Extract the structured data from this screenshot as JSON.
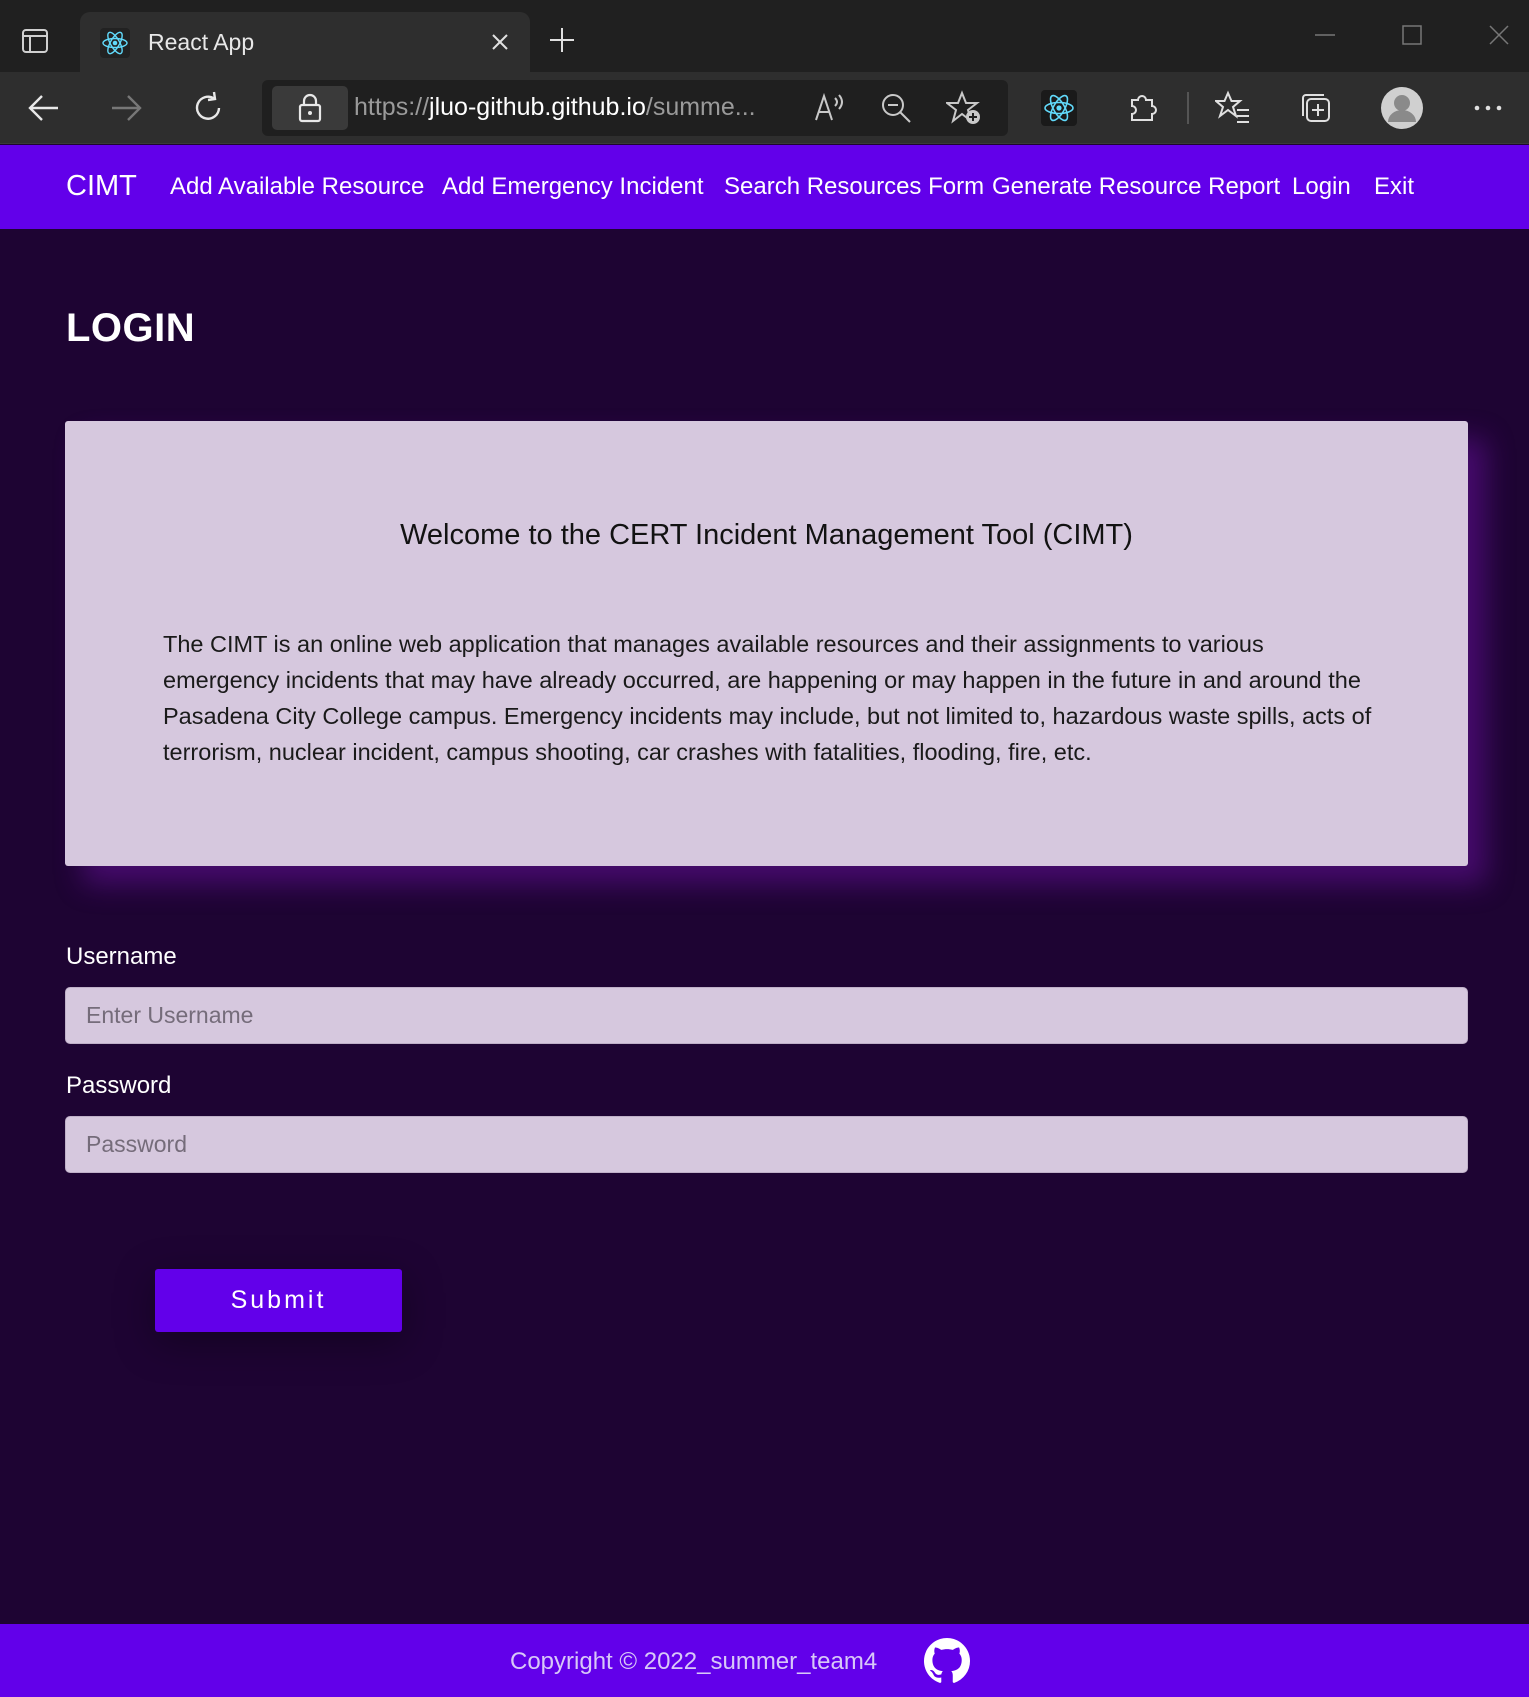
{
  "browser": {
    "tab_title": "React App",
    "url_scheme": "https://",
    "url_host": "jluo-github.github.io",
    "url_path": "/summe..."
  },
  "navbar": {
    "brand": "CIMT",
    "links": [
      "Add Available Resource",
      "Add Emergency Incident",
      "Search Resources Form",
      "Generate Resource Report",
      "Login",
      "Exit"
    ]
  },
  "page": {
    "title": "LOGIN"
  },
  "welcome": {
    "title": "Welcome to the CERT Incident Management Tool (CIMT)",
    "body": "The CIMT is an online web application that manages available resources and their assignments to various emergency incidents that may have already occurred, are happening or may happen in the future in and around the Pasadena City College campus. Emergency incidents may include, but not limited to, hazardous waste spills, acts of terrorism, nuclear incident, campus shooting, car crashes with fatalities, flooding, fire, etc."
  },
  "form": {
    "username_label": "Username",
    "username_placeholder": "Enter Username",
    "username_value": "",
    "password_label": "Password",
    "password_placeholder": "Password",
    "password_value": "",
    "submit_label": "Submit"
  },
  "footer": {
    "copyright": "Copyright © 2022_summer_team4"
  },
  "colors": {
    "accent": "#6200ea",
    "background": "#1e0433",
    "card": "#d6c8de"
  },
  "icons": [
    "sidebar-toggle-icon",
    "react-icon",
    "close-icon",
    "plus-icon",
    "back-icon",
    "forward-icon",
    "refresh-icon",
    "lock-icon",
    "read-aloud-icon",
    "zoom-out-icon",
    "add-favorite-icon",
    "extensions-icon",
    "favorites-icon",
    "collections-icon",
    "profile-icon",
    "more-icon",
    "github-icon"
  ]
}
